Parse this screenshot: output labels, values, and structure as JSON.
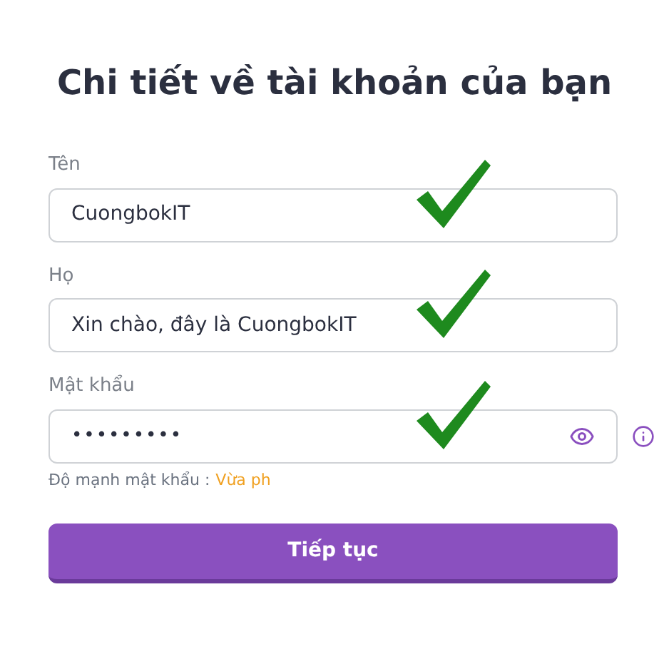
{
  "title": "Chi tiết về tài khoản của bạn",
  "fields": [
    {
      "kind": "text",
      "label": "Tên",
      "value": "CuongbokIT",
      "validated": true
    },
    {
      "kind": "text",
      "label": "Họ",
      "value": "Xin chào, đây là CuongbokIT",
      "validated": true
    },
    {
      "kind": "password",
      "label": "Mật khẩu",
      "value": "•••••••••",
      "validated": true
    }
  ],
  "strength": {
    "label": "Độ mạnh mật khẩu :",
    "value": "Vừa ph"
  },
  "button": "Tiếp tục"
}
